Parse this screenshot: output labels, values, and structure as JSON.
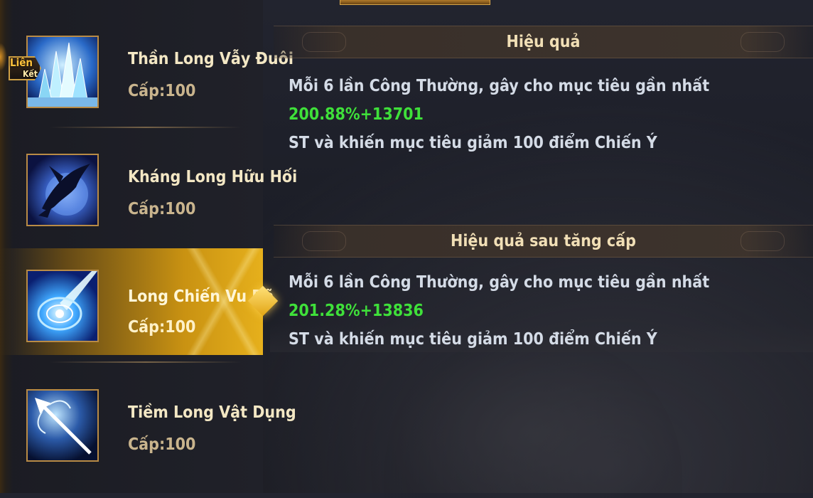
{
  "skills": [
    {
      "name": "Thần Long Vẫy Đuôi",
      "level": "Cấp:100",
      "icon": "ice-crystal-icon",
      "badge": {
        "line1": "Liên",
        "line2": "Kết"
      },
      "selected": false
    },
    {
      "name": "Kháng Long Hữu Hối",
      "level": "Cấp:100",
      "icon": "dark-dragon-icon",
      "selected": false
    },
    {
      "name": "Long Chiến Vu Dã",
      "level": "Cấp:100",
      "icon": "water-vortex-icon",
      "selected": true
    },
    {
      "name": "Tiềm Long Vật Dụng",
      "level": "Cấp:100",
      "icon": "spear-icon",
      "selected": false
    }
  ],
  "effect": {
    "title": "Hiệu quả",
    "text_before": "Mỗi 6 lần Công Thường, gây cho mục tiêu gần nhất ",
    "value": "200.88%+13701",
    "text_after": "ST và khiến mục tiêu giảm 100 điểm Chiến Ý"
  },
  "upgrade_effect": {
    "title": "Hiệu quả sau tăng cấp",
    "text_before": "Mỗi 6 lần Công Thường, gây cho mục tiêu gần nhất ",
    "value": "201.28%+13836",
    "text_after": "ST và khiến mục tiêu giảm 100 điểm Chiến Ý"
  },
  "colors": {
    "highlight_value": "#3fe03a",
    "selected_gold": "#e6b01c",
    "title_text": "#f1dfb6"
  }
}
